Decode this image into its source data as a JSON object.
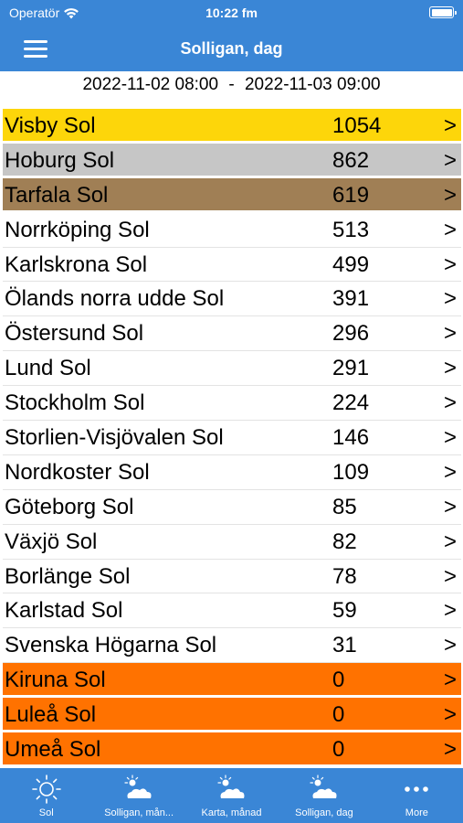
{
  "status": {
    "carrier": "Operatör",
    "time": "10:22 fm"
  },
  "nav": {
    "title": "Solligan, dag"
  },
  "date_range": {
    "start": "2022-11-02 08:00",
    "separator": "-",
    "end": "2022-11-03 09:00"
  },
  "rows": [
    {
      "name": "Visby Sol",
      "value": "1054",
      "chevron": ">"
    },
    {
      "name": "Hoburg Sol",
      "value": "862",
      "chevron": ">"
    },
    {
      "name": "Tarfala Sol",
      "value": "619",
      "chevron": ">"
    },
    {
      "name": "Norrköping Sol",
      "value": "513",
      "chevron": ">"
    },
    {
      "name": "Karlskrona Sol",
      "value": "499",
      "chevron": ">"
    },
    {
      "name": "Ölands norra udde Sol",
      "value": "391",
      "chevron": ">"
    },
    {
      "name": "Östersund Sol",
      "value": "296",
      "chevron": ">"
    },
    {
      "name": "Lund Sol",
      "value": "291",
      "chevron": ">"
    },
    {
      "name": "Stockholm Sol",
      "value": "224",
      "chevron": ">"
    },
    {
      "name": "Storlien-Visjövalen Sol",
      "value": "146",
      "chevron": ">"
    },
    {
      "name": "Nordkoster Sol",
      "value": "109",
      "chevron": ">"
    },
    {
      "name": "Göteborg Sol",
      "value": "85",
      "chevron": ">"
    },
    {
      "name": "Växjö Sol",
      "value": "82",
      "chevron": ">"
    },
    {
      "name": "Borlänge Sol",
      "value": "78",
      "chevron": ">"
    },
    {
      "name": "Karlstad Sol",
      "value": "59",
      "chevron": ">"
    },
    {
      "name": "Svenska Högarna Sol",
      "value": "31",
      "chevron": ">"
    },
    {
      "name": "Kiruna Sol",
      "value": "0",
      "chevron": ">"
    },
    {
      "name": "Luleå Sol",
      "value": "0",
      "chevron": ">"
    },
    {
      "name": "Umeå Sol",
      "value": "0",
      "chevron": ">"
    }
  ],
  "colors": {
    "bar_blue": "#3a86d6",
    "gold": "#fdd60a",
    "silver": "#c6c6c6",
    "bronze": "#a07f55",
    "zero_orange": "#ff7200"
  },
  "tabs": [
    {
      "label": "Sol",
      "icon": "sun-icon"
    },
    {
      "label": "Solligan, mån...",
      "icon": "sun-cloud-icon"
    },
    {
      "label": "Karta, månad",
      "icon": "sun-cloud-icon"
    },
    {
      "label": "Solligan, dag",
      "icon": "sun-cloud-icon"
    },
    {
      "label": "More",
      "icon": "more-dots-icon"
    }
  ]
}
